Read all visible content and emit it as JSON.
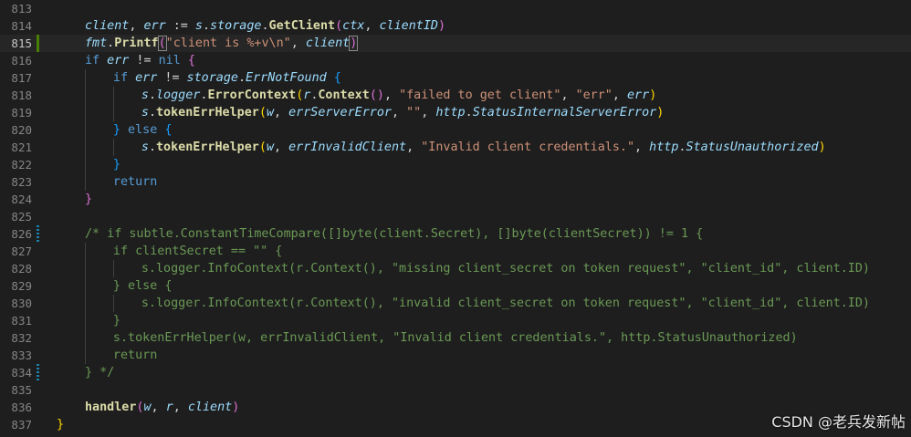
{
  "editor": {
    "lines": [
      {
        "num": "813",
        "tokens": []
      },
      {
        "num": "814",
        "tokens": [
          [
            "t-var",
            "client"
          ],
          [
            "t-op",
            ", "
          ],
          [
            "t-var",
            "err"
          ],
          [
            "t-op",
            " := "
          ],
          [
            "t-var",
            "s"
          ],
          [
            "t-op",
            "."
          ],
          [
            "t-var",
            "storage"
          ],
          [
            "t-op",
            "."
          ],
          [
            "t-fn",
            "GetClient"
          ],
          [
            "t-br2",
            "("
          ],
          [
            "t-var",
            "ctx"
          ],
          [
            "t-op",
            ", "
          ],
          [
            "t-var",
            "clientID"
          ],
          [
            "t-br2",
            ")"
          ]
        ]
      },
      {
        "num": "815",
        "current": true,
        "mark": "added",
        "tokens": [
          [
            "t-var",
            "fmt"
          ],
          [
            "t-op",
            "."
          ],
          [
            "t-fn",
            "Printf"
          ],
          [
            "t-br2 bracket-hl",
            "("
          ],
          [
            "t-str",
            "\"client is %+v\\n\""
          ],
          [
            "t-op",
            ", "
          ],
          [
            "t-var",
            "client"
          ],
          [
            "t-br2 bracket-hl",
            ")"
          ]
        ]
      },
      {
        "num": "816",
        "tokens": [
          [
            "t-kw",
            "if "
          ],
          [
            "t-var",
            "err"
          ],
          [
            "t-op",
            " != "
          ],
          [
            "t-kw",
            "nil "
          ],
          [
            "t-br2",
            "{"
          ]
        ]
      },
      {
        "num": "817",
        "tokens": [
          [
            "t-kw",
            "if "
          ],
          [
            "t-var",
            "err"
          ],
          [
            "t-op",
            " != "
          ],
          [
            "t-var",
            "storage"
          ],
          [
            "t-op",
            "."
          ],
          [
            "t-var",
            "ErrNotFound "
          ],
          [
            "t-br3",
            "{"
          ]
        ]
      },
      {
        "num": "818",
        "tokens": [
          [
            "t-var",
            "s"
          ],
          [
            "t-op",
            "."
          ],
          [
            "t-var",
            "logger"
          ],
          [
            "t-op",
            "."
          ],
          [
            "t-fn",
            "ErrorContext"
          ],
          [
            "t-br1",
            "("
          ],
          [
            "t-var",
            "r"
          ],
          [
            "t-op",
            "."
          ],
          [
            "t-fn",
            "Context"
          ],
          [
            "t-br2",
            "()"
          ],
          [
            "t-op",
            ", "
          ],
          [
            "t-str",
            "\"failed to get client\""
          ],
          [
            "t-op",
            ", "
          ],
          [
            "t-str",
            "\"err\""
          ],
          [
            "t-op",
            ", "
          ],
          [
            "t-var",
            "err"
          ],
          [
            "t-br1",
            ")"
          ]
        ]
      },
      {
        "num": "819",
        "tokens": [
          [
            "t-var",
            "s"
          ],
          [
            "t-op",
            "."
          ],
          [
            "t-fn",
            "tokenErrHelper"
          ],
          [
            "t-br1",
            "("
          ],
          [
            "t-var",
            "w"
          ],
          [
            "t-op",
            ", "
          ],
          [
            "t-var",
            "errServerError"
          ],
          [
            "t-op",
            ", "
          ],
          [
            "t-str",
            "\"\""
          ],
          [
            "t-op",
            ", "
          ],
          [
            "t-var",
            "http"
          ],
          [
            "t-op",
            "."
          ],
          [
            "t-var",
            "StatusInternalServerError"
          ],
          [
            "t-br1",
            ")"
          ]
        ]
      },
      {
        "num": "820",
        "tokens": [
          [
            "t-br3",
            "} "
          ],
          [
            "t-kw",
            "else "
          ],
          [
            "t-br3",
            "{"
          ]
        ]
      },
      {
        "num": "821",
        "tokens": [
          [
            "t-var",
            "s"
          ],
          [
            "t-op",
            "."
          ],
          [
            "t-fn",
            "tokenErrHelper"
          ],
          [
            "t-br1",
            "("
          ],
          [
            "t-var",
            "w"
          ],
          [
            "t-op",
            ", "
          ],
          [
            "t-var",
            "errInvalidClient"
          ],
          [
            "t-op",
            ", "
          ],
          [
            "t-str",
            "\"Invalid client credentials.\""
          ],
          [
            "t-op",
            ", "
          ],
          [
            "t-var",
            "http"
          ],
          [
            "t-op",
            "."
          ],
          [
            "t-var",
            "StatusUnauthorized"
          ],
          [
            "t-br1",
            ")"
          ]
        ]
      },
      {
        "num": "822",
        "tokens": [
          [
            "t-br3",
            "}"
          ]
        ]
      },
      {
        "num": "823",
        "tokens": [
          [
            "t-kw",
            "return"
          ]
        ]
      },
      {
        "num": "824",
        "tokens": [
          [
            "t-br2",
            "}"
          ]
        ]
      },
      {
        "num": "825",
        "tokens": []
      },
      {
        "num": "826",
        "mark": "modified",
        "tokens": [
          [
            "t-cm",
            "/* if subtle.ConstantTimeCompare([]byte(client.Secret), []byte(clientSecret)) != 1 {"
          ]
        ]
      },
      {
        "num": "827",
        "tokens": [
          [
            "t-cm",
            "if clientSecret == \"\" {"
          ]
        ]
      },
      {
        "num": "828",
        "tokens": [
          [
            "t-cm",
            "s.logger.InfoContext(r.Context(), \"missing client_secret on token request\", \"client_id\", client.ID)"
          ]
        ]
      },
      {
        "num": "829",
        "tokens": [
          [
            "t-cm",
            "} else {"
          ]
        ]
      },
      {
        "num": "830",
        "tokens": [
          [
            "t-cm",
            "s.logger.InfoContext(r.Context(), \"invalid client_secret on token request\", \"client_id\", client.ID)"
          ]
        ]
      },
      {
        "num": "831",
        "tokens": [
          [
            "t-cm",
            "}"
          ]
        ]
      },
      {
        "num": "832",
        "tokens": [
          [
            "t-cm",
            "s.tokenErrHelper(w, errInvalidClient, \"Invalid client credentials.\", http.StatusUnauthorized)"
          ]
        ]
      },
      {
        "num": "833",
        "tokens": [
          [
            "t-cm",
            "return"
          ]
        ]
      },
      {
        "num": "834",
        "mark": "modified",
        "tokens": [
          [
            "t-cm",
            "} */"
          ]
        ]
      },
      {
        "num": "835",
        "tokens": []
      },
      {
        "num": "836",
        "tokens": [
          [
            "t-fn",
            "handler"
          ],
          [
            "t-br2",
            "("
          ],
          [
            "t-var",
            "w"
          ],
          [
            "t-op",
            ", "
          ],
          [
            "t-var",
            "r"
          ],
          [
            "t-op",
            ", "
          ],
          [
            "t-var",
            "client"
          ],
          [
            "t-br2",
            ")"
          ]
        ]
      },
      {
        "num": "837",
        "tokens": [
          [
            "t-br1",
            "}"
          ]
        ]
      }
    ]
  },
  "watermark": "CSDN @老兵发新帖"
}
